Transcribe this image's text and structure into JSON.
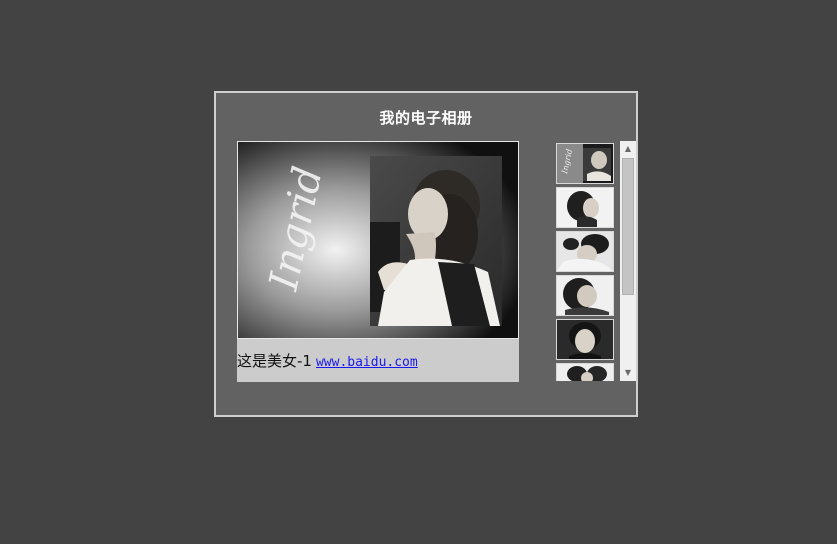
{
  "album": {
    "title": "我的电子相册",
    "main_photo": {
      "signature": "Ingrid"
    },
    "caption": {
      "text": "这是美女-1",
      "link_text": "www.baidu.com"
    },
    "thumbnails": [
      {
        "id": "thumb-1"
      },
      {
        "id": "thumb-2"
      },
      {
        "id": "thumb-3"
      },
      {
        "id": "thumb-4"
      },
      {
        "id": "thumb-5"
      },
      {
        "id": "thumb-6"
      }
    ],
    "scrollbar": {
      "up_icon": "triangle-up-icon",
      "down_icon": "triangle-down-icon",
      "position": 0.0
    }
  }
}
